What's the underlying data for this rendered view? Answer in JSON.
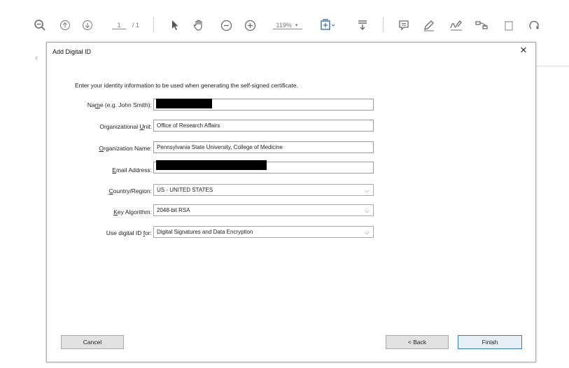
{
  "toolbar": {
    "page_current": "1",
    "page_total": "/ 1",
    "zoom": "119%",
    "icons": [
      "zoom-out-icon",
      "page-up-icon",
      "page-down-icon",
      "select-cursor-icon",
      "hand-tool-icon",
      "zoom-minus-icon",
      "zoom-plus-icon",
      "fit-page-icon",
      "scroll-mode-icon",
      "comment-icon",
      "pen-icon",
      "sign-icon",
      "share-icon",
      "delete-icon",
      "rotate-icon"
    ]
  },
  "dialog": {
    "title": "Add Digital ID",
    "instruction": "Enter your identity information to be used when generating the self-signed certificate.",
    "fields": {
      "name_label_pre": "Na",
      "name_label_u": "m",
      "name_label_post": "e (e.g. John Smith):",
      "name_value": "",
      "org_unit_label_pre": "Organizational ",
      "org_unit_label_u": "U",
      "org_unit_label_post": "nit:",
      "org_unit_value": "Office of Research Affairs",
      "org_name_label_u": "O",
      "org_name_label_post": "rganization Name:",
      "org_name_value": "Pennsylvania State University, College of Medicine",
      "email_label_u": "E",
      "email_label_post": "mail Address:",
      "email_value": "",
      "country_label_u": "C",
      "country_label_post": "ountry/Region:",
      "country_value": "US - UNITED STATES",
      "key_label_u": "K",
      "key_label_post": "ey Algorithm:",
      "key_value": "2048-bit RSA",
      "use_label_pre": "Use digital ID ",
      "use_label_u": "f",
      "use_label_post": "or:",
      "use_value": "Digital Signatures and Data Encryption"
    },
    "buttons": {
      "cancel": "Cancel",
      "back": "< Back",
      "finish": "Finish"
    }
  },
  "colors": {
    "dialog_border": "#a8a8a8",
    "primary_button_border": "#3c7fb1",
    "redaction": "#000000"
  }
}
